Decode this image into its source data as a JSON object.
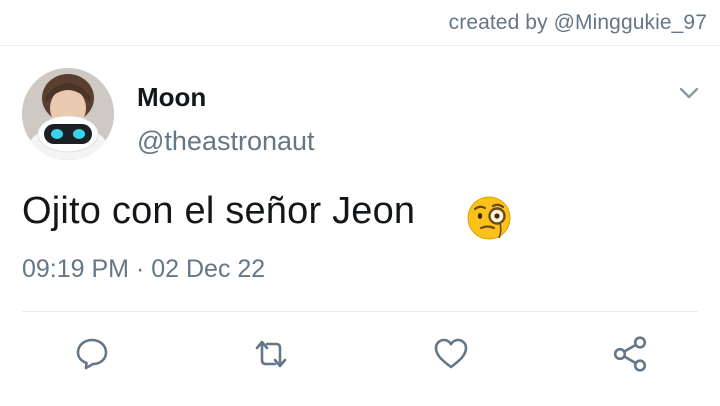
{
  "credit": "created by @Minggukie_97",
  "tweet": {
    "display_name": "Moon",
    "handle": "@theastronaut",
    "text": "Ojito con el señor Jeon",
    "emoji": "face-with-monocle",
    "time": "09:19 PM",
    "separator": "·",
    "date": "02 Dec 22"
  },
  "actions": [
    "reply-icon",
    "retweet-icon",
    "like-icon",
    "share-icon"
  ],
  "colors": {
    "text": "#14171a",
    "secondary": "#657786",
    "divider": "#e6ecf0",
    "icon": "#657786"
  }
}
